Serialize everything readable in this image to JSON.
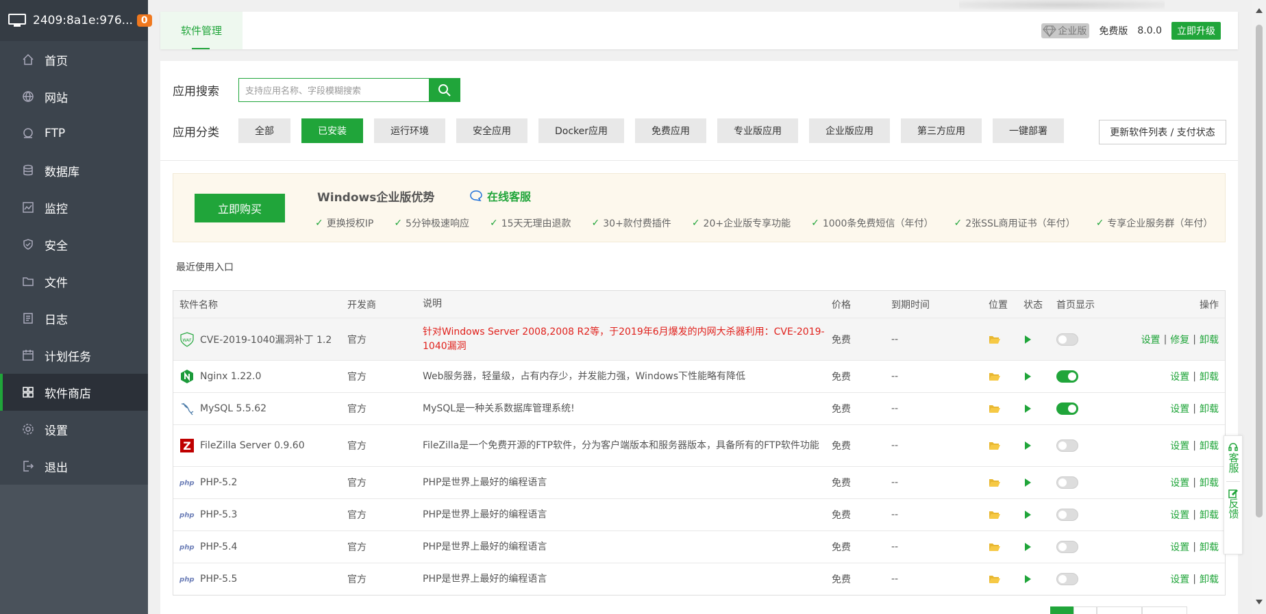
{
  "sidebar": {
    "host": "2409:8a1e:976...",
    "badge": "0",
    "items": [
      {
        "label": "首页",
        "icon": "home-icon"
      },
      {
        "label": "网站",
        "icon": "globe-icon"
      },
      {
        "label": "FTP",
        "icon": "ftp-icon"
      },
      {
        "label": "数据库",
        "icon": "database-icon"
      },
      {
        "label": "监控",
        "icon": "monitor-icon"
      },
      {
        "label": "安全",
        "icon": "shield-icon"
      },
      {
        "label": "文件",
        "icon": "folder-icon"
      },
      {
        "label": "日志",
        "icon": "log-icon"
      },
      {
        "label": "计划任务",
        "icon": "calendar-icon"
      },
      {
        "label": "软件商店",
        "icon": "grid-icon"
      },
      {
        "label": "设置",
        "icon": "gear-icon"
      },
      {
        "label": "退出",
        "icon": "exit-icon"
      }
    ],
    "active_index": 9
  },
  "topbar": {
    "tab": "软件管理",
    "enterprise_tag": "企业版",
    "free_label": "免费版",
    "version": "8.0.0",
    "upgrade": "立即升级"
  },
  "search": {
    "label": "应用搜索",
    "placeholder": "支持应用名称、字段模糊搜索"
  },
  "categories": {
    "label": "应用分类",
    "items": [
      "全部",
      "已安装",
      "运行环境",
      "安全应用",
      "Docker应用",
      "免费应用",
      "专业版应用",
      "企业版应用",
      "第三方应用",
      "一键部署"
    ],
    "active_index": 1,
    "refresh": "更新软件列表 / 支付状态"
  },
  "promo": {
    "buy": "立即购买",
    "title": "Windows企业版优势",
    "service": "在线客服",
    "features": [
      "更换授权IP",
      "5分钟极速响应",
      "15天无理由退款",
      "30+款付费插件",
      "20+企业版专享功能",
      "1000条免费短信（年付）",
      "2张SSL商用证书（年付）",
      "专享企业服务群（年付）"
    ]
  },
  "recent_label": "最近使用入口",
  "table": {
    "headers": {
      "name": "软件名称",
      "dev": "开发商",
      "desc": "说明",
      "price": "价格",
      "expire": "到期时间",
      "location": "位置",
      "status": "状态",
      "home": "首页显示",
      "ops": "操作"
    },
    "rows": [
      {
        "name": "CVE-2019-1040漏洞补丁 1.2",
        "dev": "官方",
        "desc": "针对Windows Server 2008,2008 R2等，于2019年6月爆发的内网大杀器利用：CVE-2019-1040漏洞",
        "price": "免费",
        "expire": "--",
        "home": false,
        "ops": [
          "设置",
          "修复",
          "卸载"
        ],
        "icon": "waf-icon"
      },
      {
        "name": "Nginx 1.22.0",
        "dev": "官方",
        "desc": "Web服务器，轻量级，占有内存少，并发能力强，Windows下性能略有降低",
        "price": "免费",
        "expire": "--",
        "home": true,
        "ops": [
          "设置",
          "卸载"
        ],
        "icon": "nginx-icon"
      },
      {
        "name": "MySQL 5.5.62",
        "dev": "官方",
        "desc": "MySQL是一种关系数据库管理系统!",
        "price": "免费",
        "expire": "--",
        "home": true,
        "ops": [
          "设置",
          "卸载"
        ],
        "icon": "mysql-icon"
      },
      {
        "name": "FileZilla Server 0.9.60",
        "dev": "官方",
        "desc": "FileZilla是一个免费开源的FTP软件，分为客户端版本和服务器版本，具备所有的FTP软件功能",
        "price": "免费",
        "expire": "--",
        "home": false,
        "ops": [
          "设置",
          "卸载"
        ],
        "icon": "filezilla-icon"
      },
      {
        "name": "PHP-5.2",
        "dev": "官方",
        "desc": "PHP是世界上最好的编程语言",
        "price": "免费",
        "expire": "--",
        "home": false,
        "ops": [
          "设置",
          "卸载"
        ],
        "icon": "php-icon"
      },
      {
        "name": "PHP-5.3",
        "dev": "官方",
        "desc": "PHP是世界上最好的编程语言",
        "price": "免费",
        "expire": "--",
        "home": false,
        "ops": [
          "设置",
          "卸载"
        ],
        "icon": "php-icon"
      },
      {
        "name": "PHP-5.4",
        "dev": "官方",
        "desc": "PHP是世界上最好的编程语言",
        "price": "免费",
        "expire": "--",
        "home": false,
        "ops": [
          "设置",
          "卸载"
        ],
        "icon": "php-icon"
      },
      {
        "name": "PHP-5.5",
        "dev": "官方",
        "desc": "PHP是世界上最好的编程语言",
        "price": "免费",
        "expire": "--",
        "home": false,
        "ops": [
          "设置",
          "卸载"
        ],
        "icon": "php-icon"
      }
    ]
  },
  "float": {
    "service": "客服",
    "feedback": "反馈"
  },
  "colors": {
    "accent": "#20a53a",
    "sidebar": "#3c444d",
    "warning_text": "#e0201b",
    "badge": "#f0781e"
  }
}
